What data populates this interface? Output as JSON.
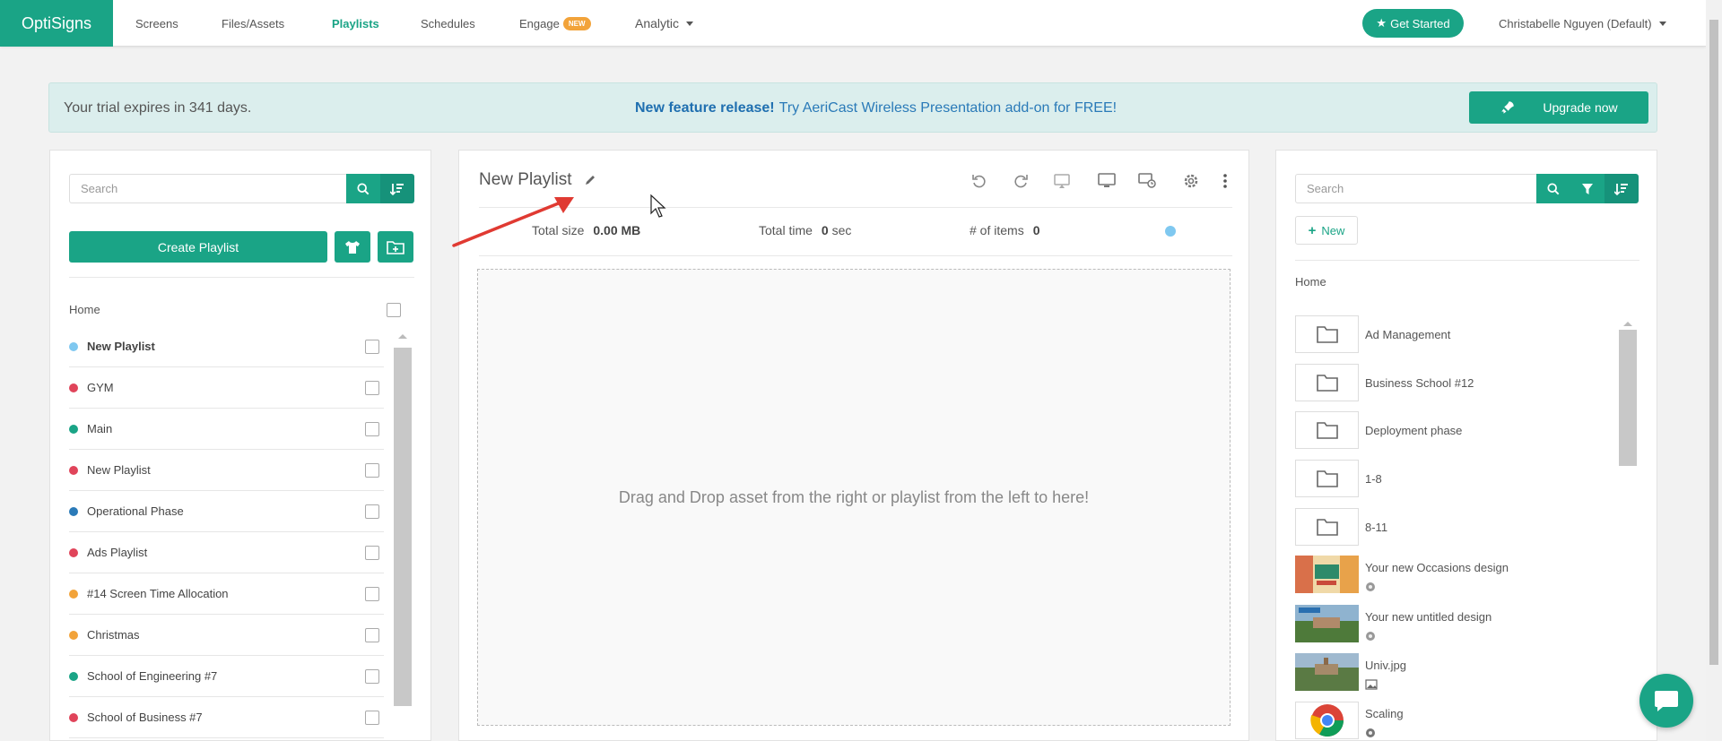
{
  "app": {
    "brand": "OptiSigns"
  },
  "nav": {
    "screens": "Screens",
    "files": "Files/Assets",
    "playlists": "Playlists",
    "schedules": "Schedules",
    "engage": "Engage",
    "engage_badge": "NEW",
    "analytic": "Analytic",
    "get_started": "Get Started",
    "user": "Christabelle Nguyen (Default)"
  },
  "banner": {
    "trial": "Your trial expires in 341 days.",
    "feature_bold": "New feature release!",
    "feature_text": "Try AeriCast Wireless Presentation add-on for FREE!",
    "upgrade": "Upgrade now"
  },
  "left": {
    "search_placeholder": "Search",
    "create_label": "Create Playlist",
    "home": "Home",
    "playlists": [
      {
        "name": "New Playlist",
        "color": "#7fc8f0",
        "bold": true
      },
      {
        "name": "GYM",
        "color": "#e0445a"
      },
      {
        "name": "Main",
        "color": "#1aa486"
      },
      {
        "name": "New Playlist",
        "color": "#e0445a"
      },
      {
        "name": "Operational Phase",
        "color": "#2a7ab8"
      },
      {
        "name": "Ads Playlist",
        "color": "#e0445a"
      },
      {
        "name": "#14 Screen Time Allocation",
        "color": "#f2a33a"
      },
      {
        "name": "Christmas",
        "color": "#f2a33a"
      },
      {
        "name": "School of Engineering #7",
        "color": "#1aa486"
      },
      {
        "name": "School of Business #7",
        "color": "#e0445a"
      }
    ]
  },
  "mid": {
    "title": "New Playlist",
    "total_size_label": "Total size",
    "total_size_value": "0.00 MB",
    "total_time_label": "Total time",
    "total_time_value": "0",
    "total_time_unit": "sec",
    "items_label": "# of items",
    "items_value": "0",
    "dropzone_text": "Drag and Drop asset from the right or playlist from the left to here!"
  },
  "right": {
    "search_placeholder": "Search",
    "new_label": "New",
    "home": "Home",
    "assets": [
      {
        "name": "Ad Management",
        "type": "folder"
      },
      {
        "name": "Business School #12",
        "type": "folder"
      },
      {
        "name": "Deployment phase",
        "type": "folder"
      },
      {
        "name": "1-8",
        "type": "folder"
      },
      {
        "name": "8-11",
        "type": "folder"
      },
      {
        "name": "Your new Occasions design",
        "type": "design"
      },
      {
        "name": "Your new untitled design",
        "type": "design"
      },
      {
        "name": "Univ.jpg",
        "type": "image"
      },
      {
        "name": "Scaling",
        "type": "web"
      }
    ]
  }
}
